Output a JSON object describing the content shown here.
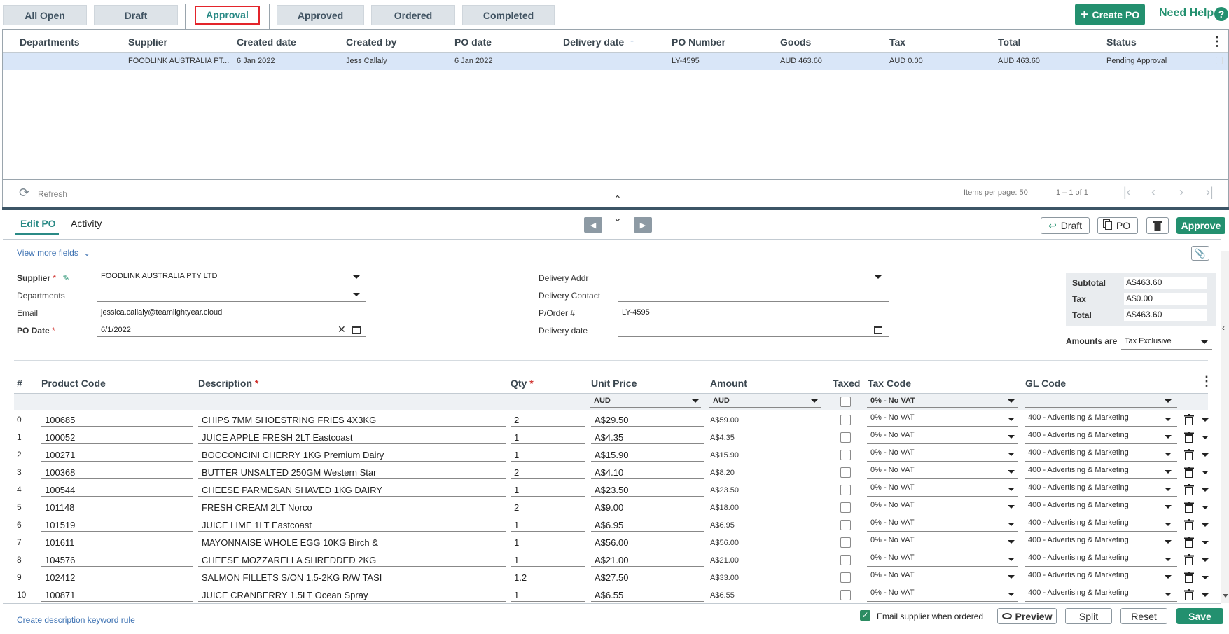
{
  "tabs": [
    "All Open",
    "Draft",
    "Approval",
    "Approved",
    "Ordered",
    "Completed"
  ],
  "active_tab": "Approval",
  "header": {
    "create_po": "Create PO",
    "need_help": "Need Help",
    "help_glyph": "?"
  },
  "po_grid": {
    "columns": [
      "Departments",
      "Supplier",
      "Created date",
      "Created by",
      "PO date",
      "Delivery date",
      "PO Number",
      "Goods",
      "Tax",
      "Total",
      "Status"
    ],
    "sorted_column": "Delivery date",
    "rows": [
      {
        "departments": "",
        "supplier": "FOODLINK AUSTRALIA PT...",
        "created_date": "6 Jan 2022",
        "created_by": "Jess Callaly",
        "po_date": "6 Jan 2022",
        "delivery_date": "",
        "po_number": "LY-4595",
        "goods": "AUD 463.60",
        "tax": "AUD 0.00",
        "total": "AUD 463.60",
        "status": "Pending Approval"
      }
    ],
    "refresh": "Refresh",
    "items_per_page_label": "Items per page:",
    "items_per_page": "50",
    "range": "1 – 1 of 1"
  },
  "edit_po": {
    "tabs": [
      "Edit PO",
      "Activity"
    ],
    "active_tab": "Edit PO",
    "buttons": {
      "draft": "Draft",
      "po": "PO",
      "approve": "Approve"
    },
    "view_more": "View more fields",
    "fields": {
      "supplier_label": "Supplier",
      "supplier": "FOODLINK AUSTRALIA PTY LTD",
      "departments_label": "Departments",
      "departments": "",
      "email_label": "Email",
      "email": "jessica.callaly@teamlightyear.cloud",
      "po_date_label": "PO Date",
      "po_date": "6/1/2022",
      "delivery_addr_label": "Delivery Addr",
      "delivery_addr": "",
      "delivery_contact_label": "Delivery Contact",
      "delivery_contact": "",
      "porder_label": "P/Order #",
      "porder": "LY-4595",
      "delivery_date_label": "Delivery date",
      "delivery_date": ""
    },
    "totals": {
      "subtotal_label": "Subtotal",
      "subtotal": "A$463.60",
      "tax_label": "Tax",
      "tax": "A$0.00",
      "total_label": "Total",
      "total": "A$463.60",
      "amounts_are_label": "Amounts are",
      "amounts_are": "Tax Exclusive"
    },
    "lines": {
      "columns": {
        "num": "#",
        "product_code": "Product Code",
        "description": "Description",
        "qty": "Qty",
        "unit_price": "Unit Price",
        "amount": "Amount",
        "taxed": "Taxed",
        "tax_code": "Tax Code",
        "gl_code": "GL Code"
      },
      "filters": {
        "unit_price_currency": "AUD",
        "amount_currency": "AUD",
        "tax_code": "0% - No VAT",
        "gl_code": ""
      },
      "rows": [
        {
          "n": "0",
          "code": "100685",
          "desc": "CHIPS 7MM SHOESTRING FRIES 4X3KG",
          "qty": "2",
          "price": "A$29.50",
          "amount": "A$59.00",
          "tax_code": "0% - No VAT",
          "gl": "400 - Advertising & Marketing"
        },
        {
          "n": "1",
          "code": "100052",
          "desc": "JUICE APPLE FRESH 2LT Eastcoast",
          "qty": "1",
          "price": "A$4.35",
          "amount": "A$4.35",
          "tax_code": "0% - No VAT",
          "gl": "400 - Advertising & Marketing"
        },
        {
          "n": "2",
          "code": "100271",
          "desc": "BOCCONCINI CHERRY 1KG Premium Dairy",
          "qty": "1",
          "price": "A$15.90",
          "amount": "A$15.90",
          "tax_code": "0% - No VAT",
          "gl": "400 - Advertising & Marketing"
        },
        {
          "n": "3",
          "code": "100368",
          "desc": "BUTTER UNSALTED 250GM Western Star",
          "qty": "2",
          "price": "A$4.10",
          "amount": "A$8.20",
          "tax_code": "0% - No VAT",
          "gl": "400 - Advertising & Marketing"
        },
        {
          "n": "4",
          "code": "100544",
          "desc": "CHEESE PARMESAN SHAVED 1KG DAIRY",
          "qty": "1",
          "price": "A$23.50",
          "amount": "A$23.50",
          "tax_code": "0% - No VAT",
          "gl": "400 - Advertising & Marketing"
        },
        {
          "n": "5",
          "code": "101148",
          "desc": "FRESH CREAM 2LT Norco",
          "qty": "2",
          "price": "A$9.00",
          "amount": "A$18.00",
          "tax_code": "0% - No VAT",
          "gl": "400 - Advertising & Marketing"
        },
        {
          "n": "6",
          "code": "101519",
          "desc": "JUICE LIME 1LT Eastcoast",
          "qty": "1",
          "price": "A$6.95",
          "amount": "A$6.95",
          "tax_code": "0% - No VAT",
          "gl": "400 - Advertising & Marketing"
        },
        {
          "n": "7",
          "code": "101611",
          "desc": "MAYONNAISE WHOLE EGG 10KG Birch &",
          "qty": "1",
          "price": "A$56.00",
          "amount": "A$56.00",
          "tax_code": "0% - No VAT",
          "gl": "400 - Advertising & Marketing"
        },
        {
          "n": "8",
          "code": "104576",
          "desc": "CHEESE MOZZARELLA SHREDDED 2KG",
          "qty": "1",
          "price": "A$21.00",
          "amount": "A$21.00",
          "tax_code": "0% - No VAT",
          "gl": "400 - Advertising & Marketing"
        },
        {
          "n": "9",
          "code": "102412",
          "desc": "SALMON FILLETS S/ON 1.5-2KG R/W TASI",
          "qty": "1.2",
          "price": "A$27.50",
          "amount": "A$33.00",
          "tax_code": "0% - No VAT",
          "gl": "400 - Advertising & Marketing"
        },
        {
          "n": "10",
          "code": "100871",
          "desc": "JUICE CRANBERRY 1.5LT Ocean Spray",
          "qty": "1",
          "price": "A$6.55",
          "amount": "A$6.55",
          "tax_code": "0% - No VAT",
          "gl": "400 - Advertising & Marketing"
        }
      ]
    },
    "footer": {
      "keyword_rule": "Create description keyword rule",
      "email_supplier": "Email supplier when ordered",
      "preview": "Preview",
      "split": "Split",
      "reset": "Reset",
      "save": "Save"
    }
  },
  "colors": {
    "accent_green": "#23906f",
    "tab_active_text": "#2a8a86",
    "highlight_red": "#e3242b",
    "selected_row": "#d9e6f8",
    "divider": "#3c5566"
  }
}
